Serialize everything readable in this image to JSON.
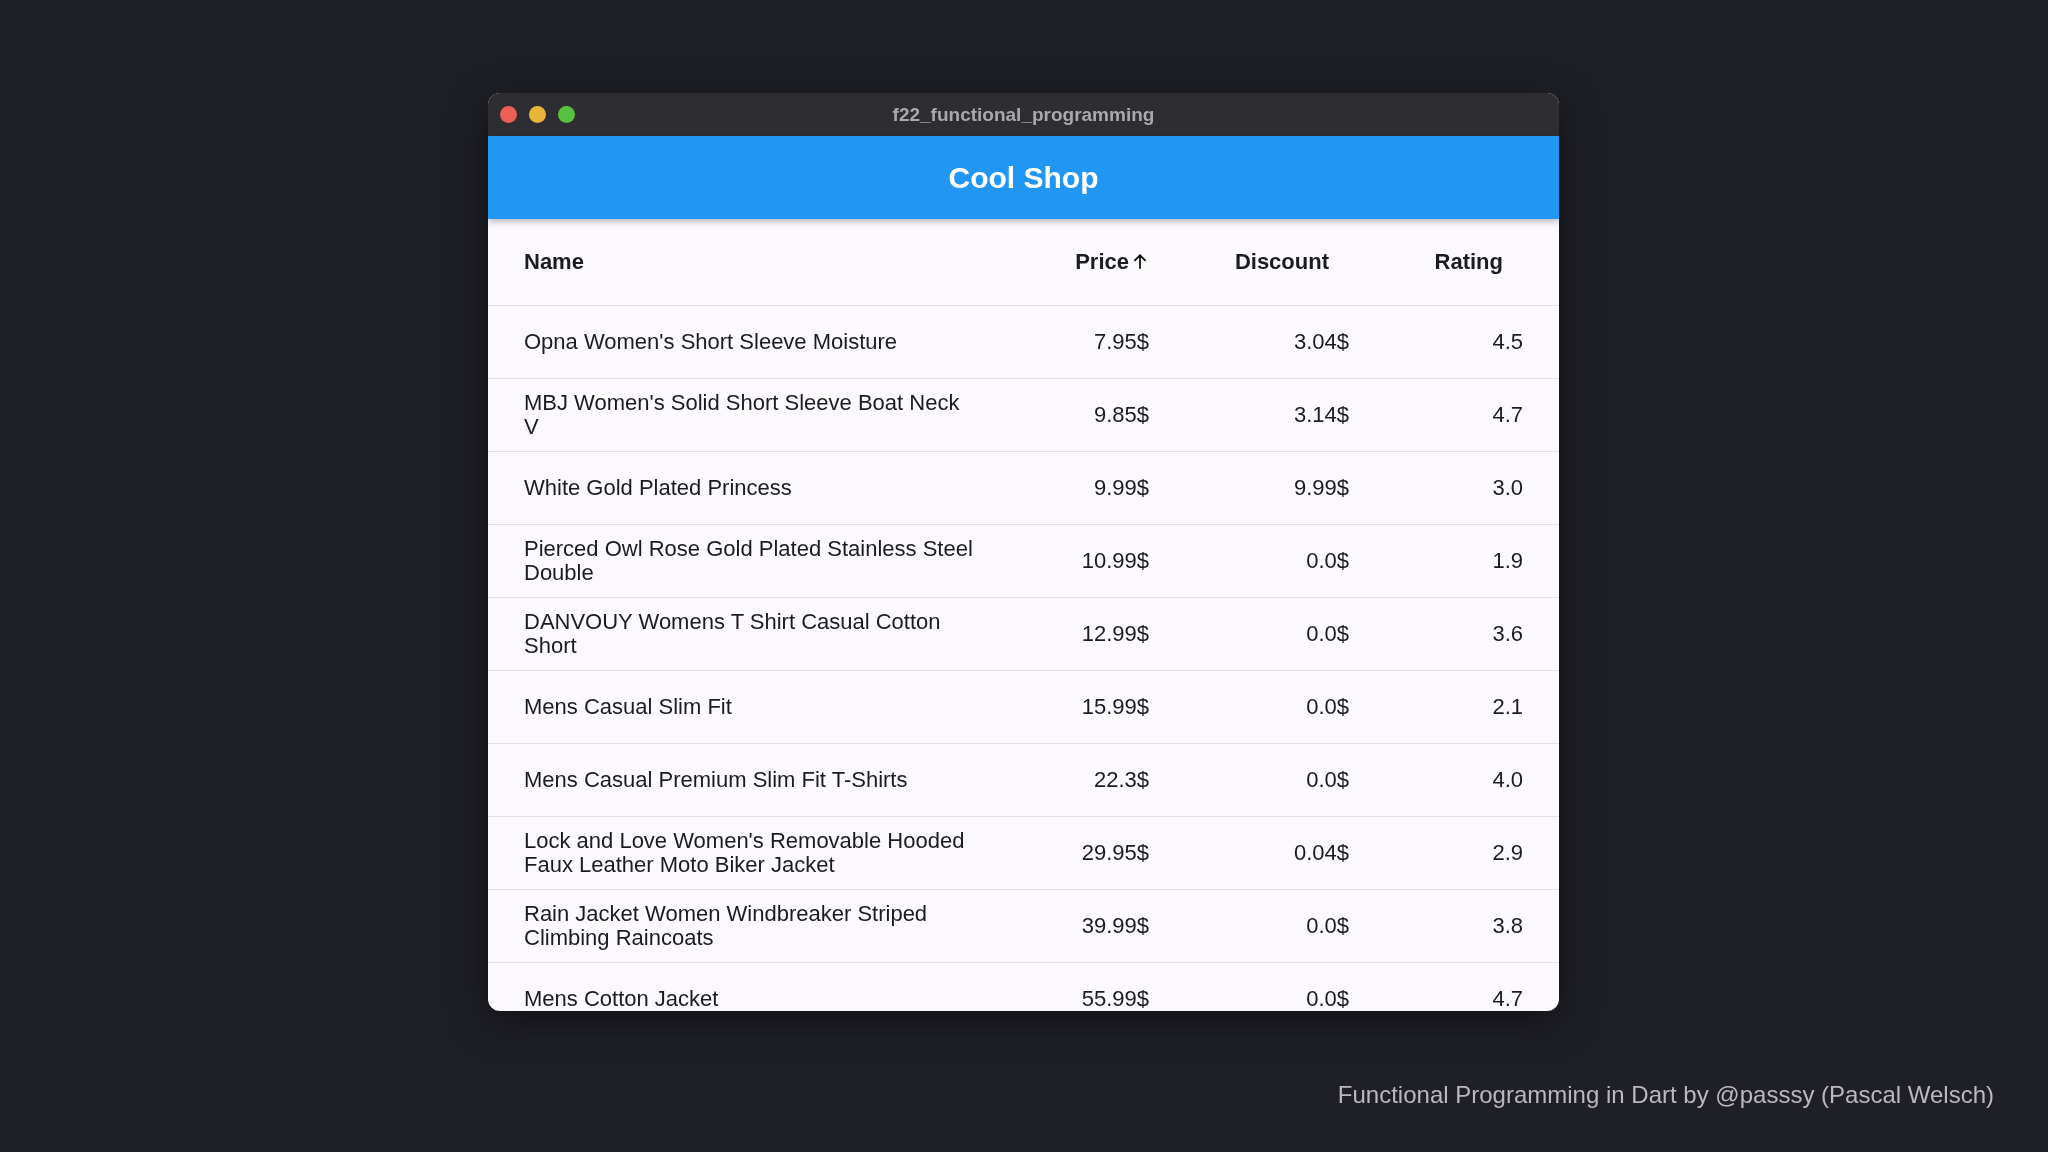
{
  "window": {
    "title": "f22_functional_programming"
  },
  "app_bar": {
    "title": "Cool Shop"
  },
  "table": {
    "columns": [
      {
        "label": "Name",
        "numeric": false,
        "sorted": false
      },
      {
        "label": "Price",
        "numeric": true,
        "sorted": true
      },
      {
        "label": "Discount",
        "numeric": true,
        "sorted": false
      },
      {
        "label": "Rating",
        "numeric": true,
        "sorted": false
      }
    ],
    "rows": [
      [
        "Opna Women's Short Sleeve Moisture",
        "7.95$",
        "3.04$",
        "4.5"
      ],
      [
        "MBJ Women's Solid Short Sleeve Boat Neck V",
        "9.85$",
        "3.14$",
        "4.7"
      ],
      [
        "White Gold Plated Princess",
        "9.99$",
        "9.99$",
        "3.0"
      ],
      [
        "Pierced Owl Rose Gold Plated Stainless Steel Double",
        "10.99$",
        "0.0$",
        "1.9"
      ],
      [
        "DANVOUY Womens T Shirt Casual Cotton Short",
        "12.99$",
        "0.0$",
        "3.6"
      ],
      [
        "Mens Casual Slim Fit",
        "15.99$",
        "0.0$",
        "2.1"
      ],
      [
        "Mens Casual Premium Slim Fit T-Shirts",
        "22.3$",
        "0.0$",
        "4.0"
      ],
      [
        "Lock and Love Women's Removable Hooded Faux Leather Moto Biker Jacket",
        "29.95$",
        "0.04$",
        "2.9"
      ],
      [
        "Rain Jacket Women Windbreaker Striped Climbing Raincoats",
        "39.99$",
        "0.0$",
        "3.8"
      ],
      [
        "Mens Cotton Jacket",
        "55.99$",
        "0.0$",
        "4.7"
      ]
    ]
  },
  "caption": "Functional Programming in Dart by @passsy (Pascal Welsch)"
}
